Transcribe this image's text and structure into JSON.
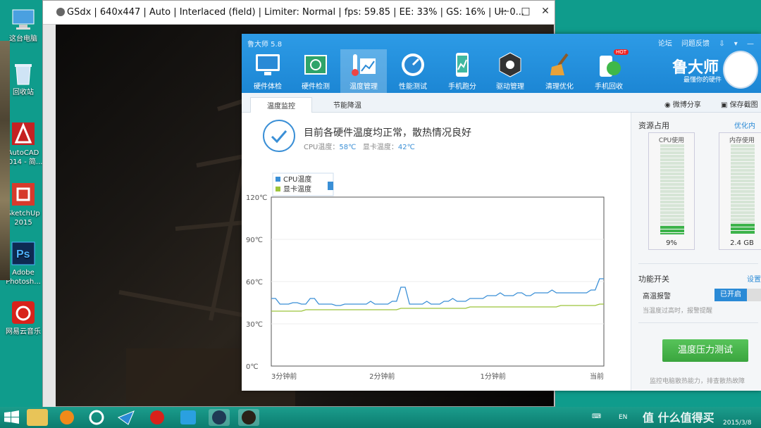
{
  "desktop": {
    "icons": [
      {
        "label": "这台电脑",
        "icon": "computer-icon",
        "color": "#4aa0e0"
      },
      {
        "label": "回收站",
        "icon": "recycle-bin-icon",
        "color": "#cfe4f5"
      },
      {
        "label": "AutoCAD 2014 - 简...",
        "icon": "autocad-icon",
        "color": "#d22b2b"
      },
      {
        "label": "SketchUp 2015",
        "icon": "sketchup-icon",
        "color": "#d63a2c"
      },
      {
        "label": "Adobe Photosh...",
        "icon": "photoshop-icon",
        "color": "#1c3a6b"
      },
      {
        "label": "网易云音乐",
        "icon": "netease-music-icon",
        "color": "#d8221b"
      }
    ]
  },
  "gsdx": {
    "title": "GSdx | 640x447 | Auto | Interlaced (field) | Limiter: Normal | fps:  59.85 | EE:  33% | GS:  16% | UI:   0...",
    "minimize": "—",
    "maximize": "□",
    "close": "✕"
  },
  "ludashi": {
    "app_title": "鲁大师 5.8",
    "top_links": [
      "论坛",
      "问题反馈"
    ],
    "nav": [
      {
        "label": "硬件体检",
        "icon": "monitor-check-icon"
      },
      {
        "label": "硬件检测",
        "icon": "hardware-board-icon"
      },
      {
        "label": "温度管理",
        "icon": "thermometer-chart-icon",
        "active": true
      },
      {
        "label": "性能测试",
        "icon": "speedometer-icon"
      },
      {
        "label": "手机跑分",
        "icon": "phone-benchmark-icon"
      },
      {
        "label": "驱动管理",
        "icon": "driver-gear-icon"
      },
      {
        "label": "清理优化",
        "icon": "broom-icon"
      },
      {
        "label": "手机回收",
        "icon": "phone-recycle-icon",
        "badge": "HOT"
      }
    ],
    "brand": "鲁大师",
    "slogan": "最懂你的硬件",
    "tabs": [
      "温度监控",
      "节能降温"
    ],
    "share": [
      "微博分享",
      "保存截图"
    ],
    "status": {
      "main": "目前各硬件温度均正常，散热情况良好",
      "cpu_label": "CPU温度：",
      "cpu_value": "58℃",
      "gpu_label": "显卡温度：",
      "gpu_value": "42℃"
    },
    "resources": {
      "title": "资源占用",
      "optimize_link": "优化内存",
      "cpu": {
        "label": "CPU使用",
        "value": "9%",
        "level": 0.09
      },
      "mem": {
        "label": "内存使用",
        "value": "2.4 GB",
        "level": 0.12
      }
    },
    "functions": {
      "title": "功能开关",
      "settings_link": "设置",
      "alarm_label": "高温报警",
      "alarm_state": "已开启",
      "alarm_desc": "当温度过高时，报警提醒"
    },
    "stress": {
      "button": "温度压力测试",
      "desc": "监控电脑散热能力，排查散热故障"
    }
  },
  "chart_data": {
    "type": "line",
    "y_ticks": [
      "120℃",
      "90℃",
      "60℃",
      "30℃",
      "0℃"
    ],
    "ylim": [
      0,
      120
    ],
    "x_ticks": [
      "3分钟前",
      "2分钟前",
      "1分钟前",
      "当前"
    ],
    "colors": {
      "cpu": "#3a8fd6",
      "gpu": "#9cc43a"
    },
    "series": [
      {
        "name": "CPU温度",
        "values": [
          48,
          48,
          44,
          44,
          44,
          45,
          45,
          44,
          44,
          48,
          48,
          44,
          44,
          44,
          44,
          43,
          43,
          44,
          44,
          44,
          44,
          44,
          44,
          46,
          44,
          44,
          44,
          44,
          46,
          46,
          56,
          56,
          44,
          44,
          44,
          44,
          46,
          44,
          44,
          44,
          46,
          46,
          48,
          46,
          46,
          46,
          48,
          48,
          48,
          48,
          50,
          50,
          50,
          52,
          50,
          50,
          50,
          52,
          52,
          50,
          50,
          52,
          52,
          52,
          52,
          54,
          52,
          52,
          52,
          52,
          52,
          52,
          52,
          52,
          54,
          54,
          62,
          62
        ]
      },
      {
        "name": "显卡温度",
        "values": [
          39,
          39,
          39,
          39,
          39,
          39,
          39,
          39,
          40,
          40,
          40,
          40,
          40,
          40,
          40,
          40,
          40,
          40,
          40,
          40,
          40,
          40,
          40,
          40,
          40,
          40,
          40,
          40,
          40,
          40,
          41,
          41,
          41,
          41,
          41,
          41,
          41,
          41,
          41,
          41,
          41,
          41,
          41,
          41,
          41,
          41,
          42,
          42,
          42,
          42,
          42,
          42,
          42,
          42,
          42,
          42,
          42,
          42,
          42,
          42,
          42,
          42,
          42,
          42,
          42,
          42,
          42,
          43,
          43,
          43,
          43,
          43,
          43,
          43,
          43,
          43,
          44,
          44
        ]
      }
    ],
    "legend": "top-left"
  },
  "taskbar": {
    "lang": "EN",
    "date": "2015/3/8",
    "watermark": "值 什么值得买"
  }
}
